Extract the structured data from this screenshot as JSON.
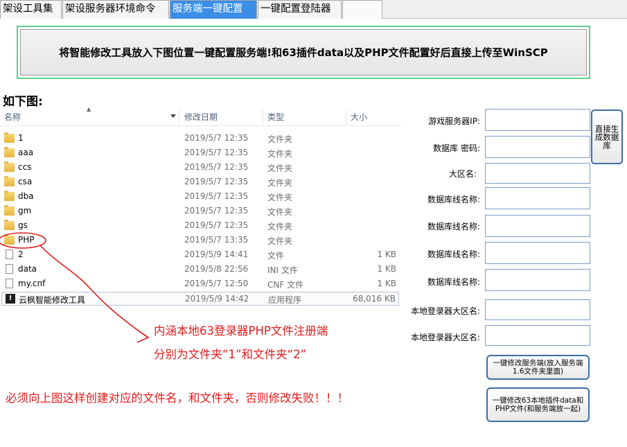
{
  "tabs": [
    {
      "label": "架设工具集"
    },
    {
      "label": "架设服务器环境命令"
    },
    {
      "label": "服务端一键配置"
    },
    {
      "label": "一键配置登陆器"
    }
  ],
  "banner": {
    "label": "将智能修改工具放入下图位置一键配置服务端!和63插件data以及PHP文件配置好后直接上传至WinSCP"
  },
  "heading": "如下图:",
  "explorer": {
    "columns": {
      "name": "名称",
      "date": "修改日期",
      "type": "类型",
      "size": "大小"
    },
    "rows": [
      {
        "name": "1",
        "date": "2019/5/7 12:35",
        "type": "文件夹",
        "size": ""
      },
      {
        "name": "aaa",
        "date": "2019/5/7 12:35",
        "type": "文件夹",
        "size": ""
      },
      {
        "name": "ccs",
        "date": "2019/5/7 12:35",
        "type": "文件夹",
        "size": ""
      },
      {
        "name": "csa",
        "date": "2019/5/7 12:35",
        "type": "文件夹",
        "size": ""
      },
      {
        "name": "dba",
        "date": "2019/5/7 12:35",
        "type": "文件夹",
        "size": ""
      },
      {
        "name": "gm",
        "date": "2019/5/7 12:35",
        "type": "文件夹",
        "size": ""
      },
      {
        "name": "gs",
        "date": "2019/5/7 12:35",
        "type": "文件夹",
        "size": ""
      },
      {
        "name": "PHP",
        "date": "2019/5/7 13:35",
        "type": "文件夹",
        "size": ""
      },
      {
        "name": "2",
        "date": "2019/5/9 14:41",
        "type": "文件",
        "size": "1 KB"
      },
      {
        "name": "data",
        "date": "2019/5/8 22:56",
        "type": "INI 文件",
        "size": "1 KB"
      },
      {
        "name": "my.cnf",
        "date": "2019/5/7 12:50",
        "type": "CNF 文件",
        "size": "1 KB"
      },
      {
        "name": "云枫智能修改工具",
        "date": "2019/5/9 14:42",
        "type": "应用程序",
        "size": "68,016 KB"
      }
    ]
  },
  "notes": {
    "line1": "内涵本地63登录器PHP文件注册端",
    "line2": "分别为文件夹“1”和文件夹“2”",
    "warning": "必须向上图这样创建对应的文件名，和文件夹，否则修改失败！！！"
  },
  "form": {
    "labels": [
      "游戏服务器IP:",
      "数据库 密码:",
      "大区名:",
      "数据库线名称:",
      "数据库线名称:",
      "数据库线名称:",
      "数据库线名称:",
      "本地登录器大区名:",
      "本地登录器大区名:"
    ],
    "values": [
      "",
      "",
      "",
      "",
      "",
      "",
      "",
      "",
      ""
    ]
  },
  "buttons": {
    "generate_db": "直接生成数据库",
    "modify_server": "一键修改服务端(放入服务端1.6文件夹里面)",
    "modify_plugin": "一键修改63本地插件data和PHP文件(和服务端放一起)"
  },
  "colors": {
    "active_tab": "#3a8ee6",
    "banner_border": "#5cd08a",
    "annotation": "#e01b1b"
  }
}
